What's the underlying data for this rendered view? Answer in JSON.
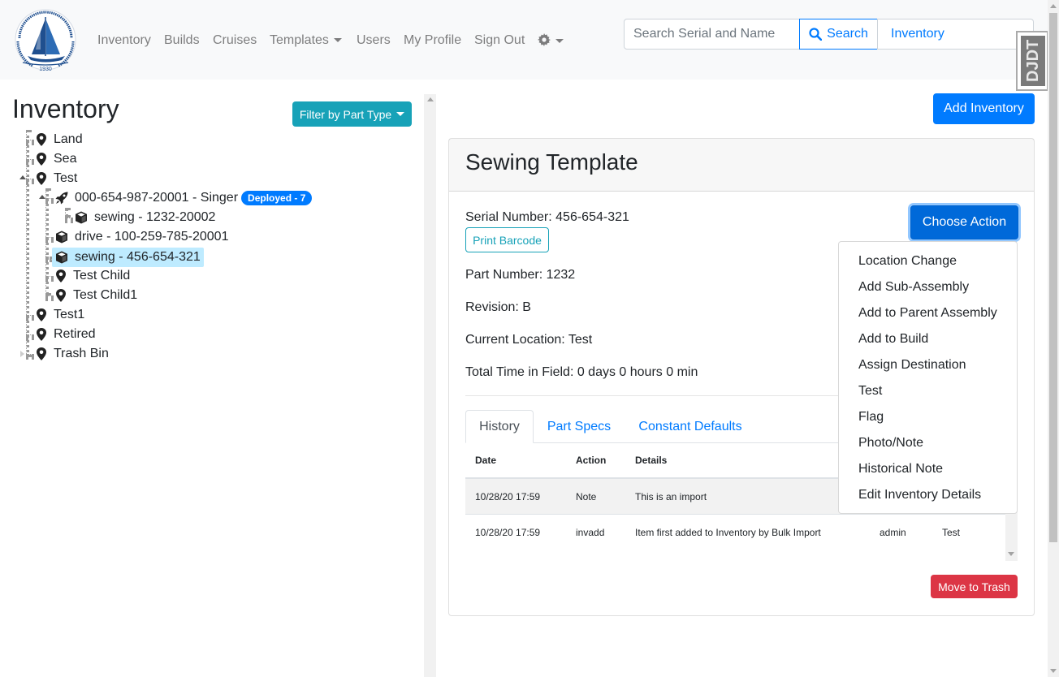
{
  "navbar": {
    "logo": {
      "text_top": "WOODS HOLE OCEANOGRAPHIC INSTITUTION",
      "year": "1930"
    },
    "links": [
      "Inventory",
      "Builds",
      "Cruises",
      "Templates",
      "Users",
      "My Profile",
      "Sign Out"
    ],
    "settings_icon": "gear-icon",
    "search": {
      "placeholder": "Search Serial and Name",
      "button_label": "Search",
      "scope": "Inventory"
    },
    "debug_toolbar_label": "DJDT"
  },
  "left": {
    "title": "Inventory",
    "filter_label": "Filter by Part Type",
    "tree": [
      {
        "label": "Land",
        "icon": "map-marker-icon"
      },
      {
        "label": "Sea",
        "icon": "map-marker-icon"
      },
      {
        "label": "Test",
        "icon": "map-marker-icon"
      },
      {
        "label": "000-654-987-20001 - Singer",
        "icon": "rocket-icon",
        "badge": "Deployed - 7"
      },
      {
        "label": "sewing - 1232-20002",
        "icon": "cube-icon"
      },
      {
        "label": "drive - 100-259-785-20001",
        "icon": "cube-icon"
      },
      {
        "label": "sewing - 456-654-321",
        "icon": "cube-icon",
        "selected": true
      },
      {
        "label": "Test Child",
        "icon": "map-marker-icon"
      },
      {
        "label": "Test Child1",
        "icon": "map-marker-icon"
      },
      {
        "label": "Test1",
        "icon": "map-marker-icon"
      },
      {
        "label": "Retired",
        "icon": "map-marker-icon"
      },
      {
        "label": "Trash Bin",
        "icon": "map-marker-icon"
      }
    ]
  },
  "right": {
    "add_inventory_label": "Add Inventory",
    "card_title": "Sewing Template",
    "serial_number": "Serial Number: 456-654-321",
    "print_barcode_label": "Print Barcode",
    "choose_action_label": "Choose Action",
    "part_number": "Part Number: 1232",
    "revision": "Revision: B",
    "current_location": "Current Location: Test",
    "time_in_field": "Total Time in Field: 0 days 0 hours 0 min",
    "tabs": [
      "History",
      "Part Specs",
      "Constant Defaults"
    ],
    "history": {
      "headers": [
        "Date",
        "Action",
        "Details"
      ],
      "rows": [
        {
          "date": "10/28/20 17:59",
          "action": "Note",
          "details": "This is an import",
          "user": "",
          "location": ""
        },
        {
          "date": "10/28/20 17:59",
          "action": "invadd",
          "details": "Item first added to Inventory by Bulk Import",
          "user": "admin",
          "location": "Test"
        }
      ]
    },
    "move_to_trash_label": "Move to Trash"
  },
  "action_menu": {
    "items": [
      "Location Change",
      "Add Sub-Assembly",
      "Add to Parent Assembly",
      "Add to Build",
      "Assign Destination",
      "Test",
      "Flag",
      "Photo/Note",
      "Historical Note",
      "Edit Inventory Details"
    ]
  },
  "colors": {
    "primary": "#007bff",
    "info": "#17a2b8",
    "danger": "#dc3545",
    "selected_node": "#beebff",
    "navbar_bg": "#f8f9fa",
    "logo_blue": "#1f4f8f"
  }
}
